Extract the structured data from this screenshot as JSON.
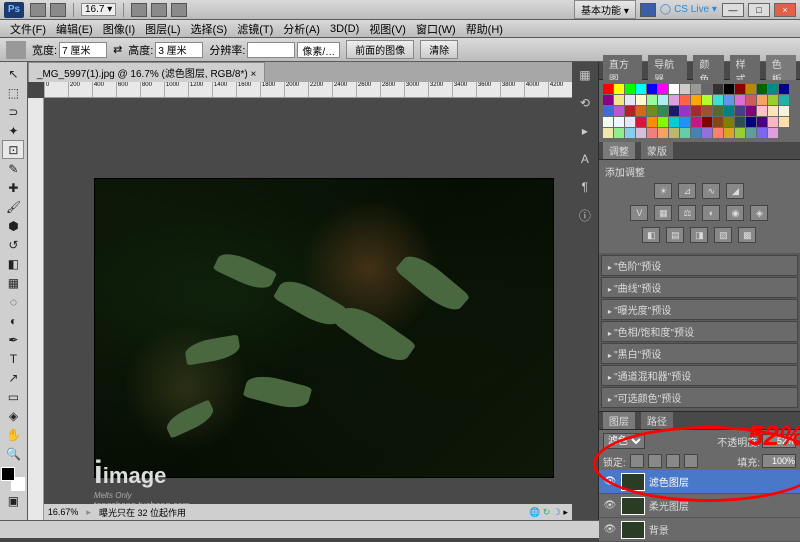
{
  "titlebar": {
    "logo": "Ps",
    "zoom_combo": "16.7 ▾",
    "basic_function": "基本功能 ▾",
    "cslive": "CS Live ▾",
    "win_min": "—",
    "win_max": "□",
    "win_close": "×"
  },
  "menu": {
    "items": [
      "文件(F)",
      "编辑(E)",
      "图像(I)",
      "图层(L)",
      "选择(S)",
      "滤镜(T)",
      "分析(A)",
      "3D(D)",
      "视图(V)",
      "窗口(W)",
      "帮助(H)"
    ]
  },
  "options": {
    "width_label": "宽度:",
    "width_value": "7 厘米",
    "height_label": "高度:",
    "height_value": "3 厘米",
    "res_label": "分辨率:",
    "res_value": "",
    "res_unit": "像素/…",
    "front_image_btn": "前面的图像",
    "clear_btn": "清除"
  },
  "document": {
    "tab_title": "_MG_5997(1).jpg @ 16.7% (滤色图层, RGB/8*) ×",
    "zoom_status": "16.67%",
    "exposure_status": "曝光只在 32 位起作用"
  },
  "ruler_ticks": [
    "0",
    "200",
    "400",
    "600",
    "800",
    "1000",
    "1200",
    "1400",
    "1600",
    "1800",
    "2000",
    "2200",
    "2400",
    "2600",
    "2800",
    "3000",
    "3200",
    "3400",
    "3600",
    "3800",
    "4000",
    "4200"
  ],
  "panel_tabs": {
    "row1": [
      "直方图",
      "导航器",
      "颜色",
      "样式",
      "色板"
    ]
  },
  "swatch_colors": [
    "#ff0000",
    "#ffff00",
    "#00ff00",
    "#00ffff",
    "#0000ff",
    "#ff00ff",
    "#ffffff",
    "#cccccc",
    "#999999",
    "#666666",
    "#333333",
    "#000000",
    "#8b0000",
    "#b8860b",
    "#006400",
    "#008b8b",
    "#00008b",
    "#8b008b",
    "#f0e68c",
    "#e6e6fa",
    "#fffacd",
    "#98fb98",
    "#afeeee",
    "#dda0dd",
    "#ff6347",
    "#ffa500",
    "#adff2f",
    "#40e0d0",
    "#6495ed",
    "#da70d6",
    "#cd5c5c",
    "#f4a460",
    "#9acd32",
    "#20b2aa",
    "#4169e1",
    "#ba55d3",
    "#b22222",
    "#d2691e",
    "#6b8e23",
    "#2e8b57",
    "#191970",
    "#9932cc",
    "#a52a2a",
    "#a0522d",
    "#556b2f",
    "#008080",
    "#483d8b",
    "#800080",
    "#ffc0cb",
    "#ffe4b5",
    "#f5f5dc",
    "#f0fff0",
    "#f0f8ff",
    "#e6e6fa",
    "#dc143c",
    "#ff8c00",
    "#7fff00",
    "#00ced1",
    "#1e90ff",
    "#c71585",
    "#800000",
    "#8b4513",
    "#808000",
    "#2f4f4f",
    "#000080",
    "#4b0082",
    "#ffb6c1",
    "#ffdead",
    "#eee8aa",
    "#90ee90",
    "#87ceeb",
    "#d8bfd8",
    "#f08080",
    "#f4a460",
    "#bdb76b",
    "#66cdaa",
    "#4682b4",
    "#9370db",
    "#fa8072",
    "#daa520",
    "#9acd32",
    "#5f9ea0",
    "#7b68ee",
    "#dda0dd"
  ],
  "adjust": {
    "tab1": "调整",
    "tab2": "蒙版",
    "title": "添加调整"
  },
  "presets": {
    "items": [
      "\"色阶\"预设",
      "\"曲线\"预设",
      "\"曝光度\"预设",
      "\"色相/饱和度\"预设",
      "\"黑白\"预设",
      "\"通道混和器\"预设",
      "\"可选颜色\"预设"
    ]
  },
  "layers": {
    "tab_layers": "图层",
    "tab_paths": "路径",
    "blend_mode": "滤色",
    "opacity_label": "不透明度:",
    "opacity_value": "52%",
    "lock_label": "锁定:",
    "fill_label": "填充:",
    "fill_value": "100%",
    "items": [
      {
        "name": "滤色图层",
        "selected": true
      },
      {
        "name": "柔光图层",
        "selected": false
      },
      {
        "name": "背景",
        "selected": false
      }
    ]
  },
  "annotation": {
    "big_text": "52%"
  },
  "watermark": {
    "line1": "image",
    "script": "Melts Only",
    "line2": "tangcheng.tuchong.com"
  }
}
